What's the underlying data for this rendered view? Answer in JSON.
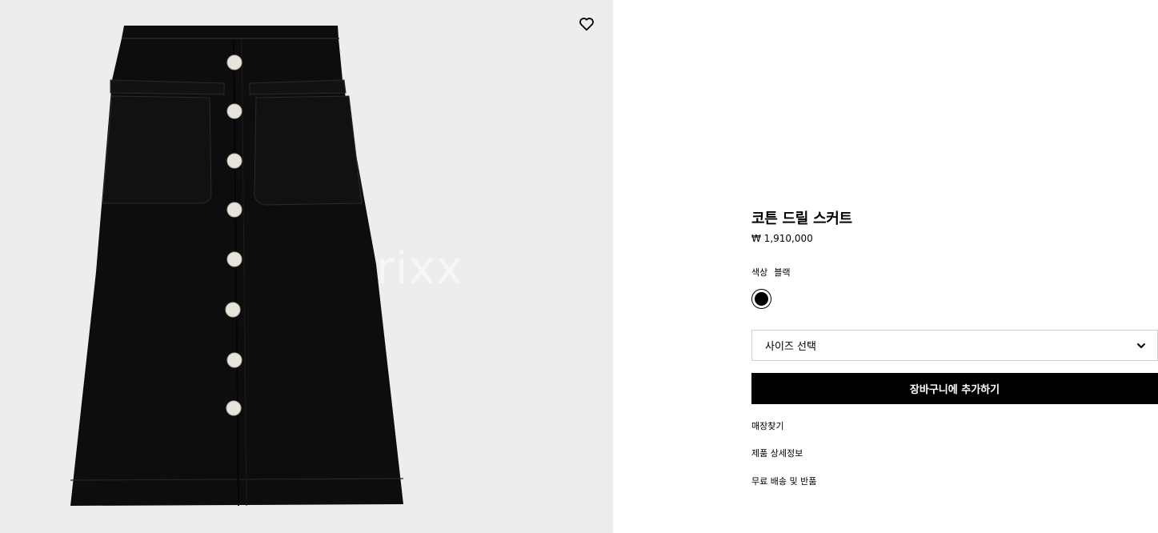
{
  "gallery": {
    "image": "black-cotton-drill-button-front-skirt",
    "watermark": "rixx",
    "wishlist_icon": "heart-icon"
  },
  "product": {
    "title": "코튼 드릴 스커트",
    "price": "₩ 1,910,000",
    "color_label": "색상",
    "color_value": "블랙",
    "swatches": [
      {
        "name": "블랙",
        "hex": "#000000",
        "selected": true
      }
    ]
  },
  "size_select": {
    "placeholder": "사이즈 선택",
    "icon": "chevron-down-icon"
  },
  "actions": {
    "add_to_cart": "장바구니에 추가하기"
  },
  "links": {
    "find_store": "매장찾기",
    "product_details": "제품 상세정보",
    "shipping_returns": "무료 배송 및 반품"
  },
  "colors": {
    "gallery_bg": "#ECEDEF",
    "primary": "#000000",
    "border": "#CFCFCF"
  }
}
